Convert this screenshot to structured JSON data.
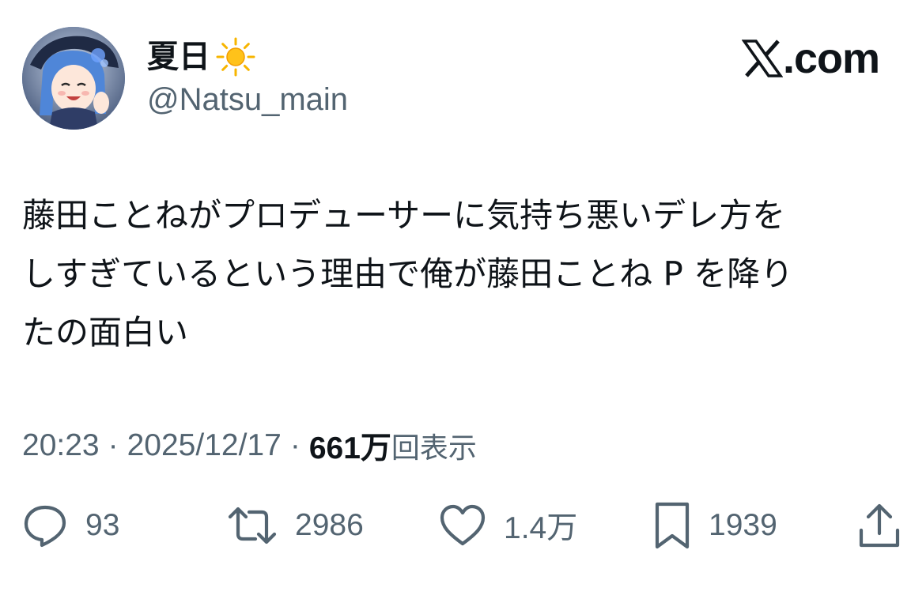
{
  "user": {
    "display_name": "夏日",
    "handle": "@Natsu_main",
    "name_emoji_icon": "sun-icon"
  },
  "brand": {
    "logo_icon": "x-logo-icon",
    "text": ".com"
  },
  "tweet": {
    "lines": [
      "藤田ことねがプロデューサーに気持ち悪いデレ方を",
      "しすぎているという理由で俺が藤田ことね P を降り",
      "たの面白い"
    ]
  },
  "meta": {
    "time": "20:23",
    "separator": "·",
    "date": "2025/12/17",
    "views_count": "661万",
    "views_label": "回表示"
  },
  "actions": {
    "reply_count": "93",
    "retweet_count": "2986",
    "like_count": "1.4万",
    "bookmark_count": "1939"
  },
  "colors": {
    "text_primary": "#0f1419",
    "text_secondary": "#536471",
    "sun": "#f7b500"
  }
}
